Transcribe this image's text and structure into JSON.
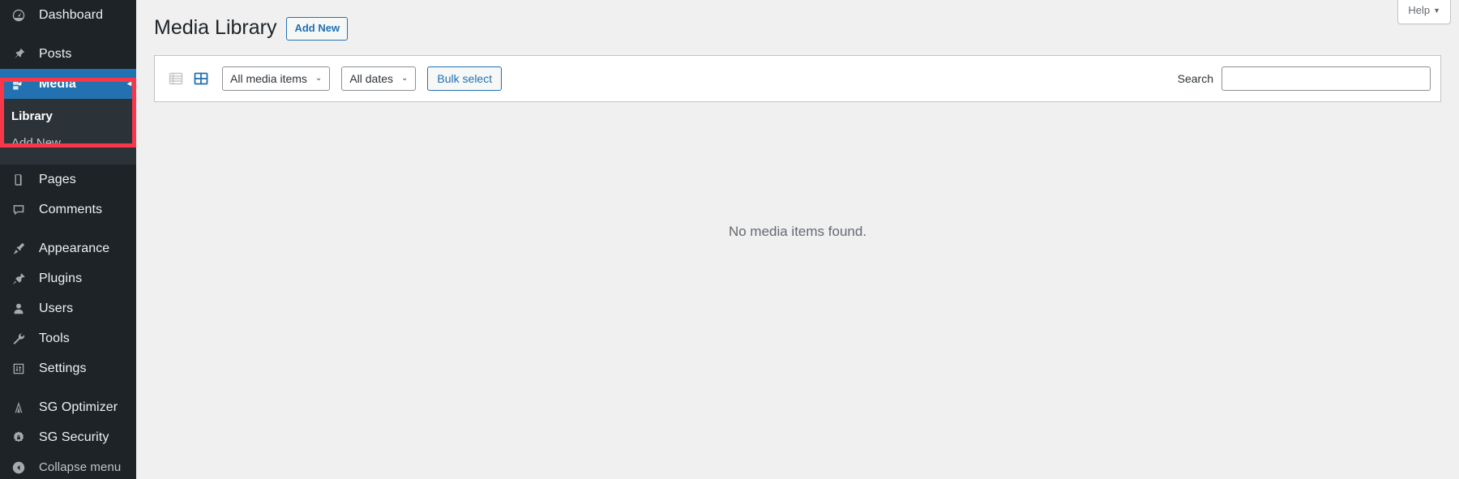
{
  "sidebar": {
    "items": [
      {
        "label": "Dashboard",
        "icon": "dashboard-gauge-icon",
        "active": false
      },
      {
        "label": "Posts",
        "icon": "pushpin-icon",
        "active": false
      },
      {
        "label": "Media",
        "icon": "media-camera-icon",
        "active": true
      },
      {
        "label": "Pages",
        "icon": "page-document-icon",
        "active": false
      },
      {
        "label": "Comments",
        "icon": "comment-bubble-icon",
        "active": false
      },
      {
        "label": "Appearance",
        "icon": "paintbrush-icon",
        "active": false
      },
      {
        "label": "Plugins",
        "icon": "plug-icon",
        "active": false
      },
      {
        "label": "Users",
        "icon": "user-icon",
        "active": false
      },
      {
        "label": "Tools",
        "icon": "wrench-icon",
        "active": false
      },
      {
        "label": "Settings",
        "icon": "settings-sliders-icon",
        "active": false
      },
      {
        "label": "SG Optimizer",
        "icon": "sg-optimizer-icon",
        "active": false
      },
      {
        "label": "SG Security",
        "icon": "sg-security-shield-icon",
        "active": false
      }
    ],
    "media_submenu": [
      {
        "label": "Library",
        "current": true
      },
      {
        "label": "Add New",
        "current": false
      }
    ],
    "collapse_label": "Collapse menu",
    "collapse_icon": "collapse-arrow-icon",
    "active_arrow": "◂",
    "colors": {
      "background": "#1d2327",
      "submenu_background": "#2c3338",
      "active_background": "#2271b1",
      "annotation": "#f8374a"
    }
  },
  "header": {
    "help_tab_label": "Help",
    "help_tab_caret": "▼"
  },
  "page": {
    "title": "Media Library",
    "add_new_label": "Add New"
  },
  "toolbar": {
    "list_view_icon": "list-view-icon",
    "grid_view_icon": "grid-view-icon",
    "media_filter": {
      "value": "All media items",
      "caret": "⌄"
    },
    "date_filter": {
      "value": "All dates",
      "caret": "⌄"
    },
    "bulk_select_label": "Bulk select",
    "search_label": "Search",
    "search_value": "",
    "search_placeholder": ""
  },
  "content": {
    "empty_message": "No media items found."
  }
}
